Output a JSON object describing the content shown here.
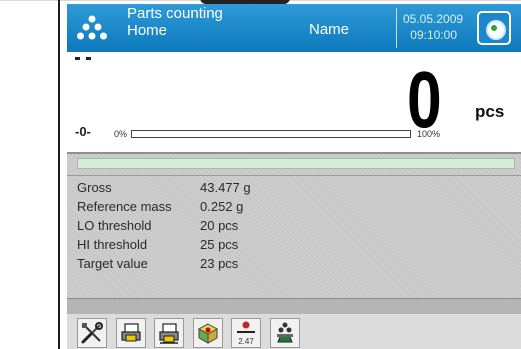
{
  "header": {
    "mode_title": "Parts counting",
    "mode_subtitle": "Home",
    "user_name": "Name",
    "date": "05.05.2009",
    "time": "09:10:00"
  },
  "weighing": {
    "zero_indicator": "-0-",
    "result_value": "0",
    "unit": "pcs",
    "range_min_label": "0%",
    "range_max_label": "100%",
    "range_fill_fraction": 0
  },
  "info_rows": [
    {
      "label": "Gross",
      "value": "43.477 g"
    },
    {
      "label": "Reference mass",
      "value": "0.252 g"
    },
    {
      "label": "LO threshold",
      "value": "20 pcs"
    },
    {
      "label": "HI threshold",
      "value": "25 pcs"
    },
    {
      "label": "Target value",
      "value": "23 pcs"
    }
  ],
  "toolbar": {
    "tare_value": "2.47"
  },
  "colors": {
    "header_blue": "#0c79bd",
    "panel_gray": "#c7c7c7",
    "threshold_green": "#d6ecd5"
  },
  "icons": [
    "parts-counting-icon",
    "level-icon",
    "stability-marker-icon",
    "settings-icon",
    "printout-header-icon",
    "printout-footer-icon",
    "database-icon",
    "tare-icon",
    "reference-mass-icon"
  ]
}
